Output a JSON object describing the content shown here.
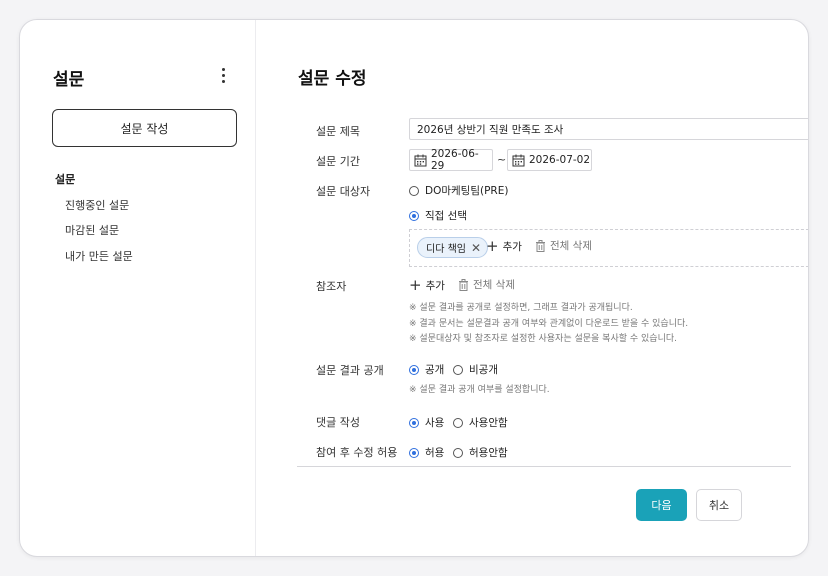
{
  "sidebar": {
    "title": "설문",
    "create_button": "설문 작성",
    "nav_heading": "설문",
    "items": [
      {
        "label": "진행중인 설문"
      },
      {
        "label": "마감된 설문"
      },
      {
        "label": "내가 만든 설문"
      }
    ]
  },
  "main": {
    "title": "설문 수정",
    "survey_title": {
      "label": "설문 제목",
      "value": "2026년 상반기 직원 만족도 조사"
    },
    "period": {
      "label": "설문 기간",
      "start": "2026-06-29",
      "separator": "~",
      "end": "2026-07-02"
    },
    "target": {
      "label": "설문 대상자",
      "options": [
        {
          "label": "DO마케팅팀(PRE)",
          "selected": false
        },
        {
          "label": "직접 선택",
          "selected": true
        }
      ],
      "chips": [
        {
          "label": "디다 책임"
        }
      ],
      "add_label": "추가",
      "delete_all_label": "전체 삭제"
    },
    "viewer": {
      "label": "참조자",
      "add_label": "추가",
      "delete_all_label": "전체 삭제",
      "notes": [
        "※ 설문 결과를 공개로 설정하면, 그래프 결과가 공개됩니다.",
        "※ 결과 문서는 설문결과 공개 여부와 관계없이 다운로드 받을 수 있습니다.",
        "※ 설문대상자 및 참조자로 설정한 사용자는 설문을 복사할 수 있습니다."
      ]
    },
    "result_public": {
      "label": "설문 결과 공개",
      "options": [
        {
          "label": "공개",
          "selected": true
        },
        {
          "label": "비공개",
          "selected": false
        }
      ],
      "note": "※ 설문 결과 공개 여부를 설정합니다."
    },
    "comments": {
      "label": "댓글 작성",
      "options": [
        {
          "label": "사용",
          "selected": true
        },
        {
          "label": "사용안함",
          "selected": false
        }
      ]
    },
    "edit_after": {
      "label": "참여 후 수정 허용",
      "options": [
        {
          "label": "허용",
          "selected": true
        },
        {
          "label": "허용안함",
          "selected": false
        }
      ]
    },
    "buttons": {
      "next": "다음",
      "cancel": "취소"
    }
  },
  "colors": {
    "accent": "#1aa2b8",
    "radio": "#2f6fde",
    "chip_bg": "#eaf2fb"
  },
  "icons": [
    "more-vertical-icon",
    "calendar-icon",
    "plus-icon",
    "trash-icon",
    "close-icon"
  ]
}
